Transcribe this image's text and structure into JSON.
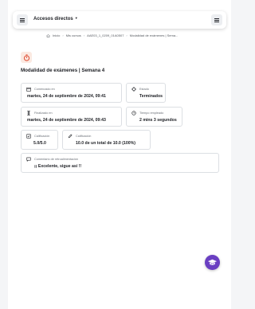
{
  "topbar": {
    "shortcuts_label": "Accesos directos"
  },
  "breadcrumb": {
    "items": [
      "Inicio",
      "Mis cursos",
      "AAE03_1_0209_01A0507",
      "Modalidad de exámenes | Sema..."
    ]
  },
  "page": {
    "title": "Modalidad de exámenes | Semana 4"
  },
  "details": {
    "started_label": "Comenzado en",
    "started_value": "martes, 24 de septiembre de 2024, 09:41",
    "state_label": "Estado",
    "state_value": "Terminados",
    "finished_label": "Finalizado en",
    "finished_value": "martes, 24 de septiembre de 2024, 09:43",
    "time_label": "Tiempo empleado",
    "time_value": "2 mins 3 segundos",
    "grade1_label": "Calificación",
    "grade1_value": "5.0/5.0",
    "grade2_label": "Calificación",
    "grade2_value": "10.0 de un total de 10.0 (100%)",
    "feedback_label": "Comentario de retroalimentación",
    "feedback_value": "¡¡ Excelente, sigue así !!"
  },
  "icons": {
    "quiz": "quiz-timer-icon",
    "assistant": "assistant-hat-icon"
  },
  "colors": {
    "accent": "#e0533b",
    "assistant": "#6a3fc2"
  }
}
